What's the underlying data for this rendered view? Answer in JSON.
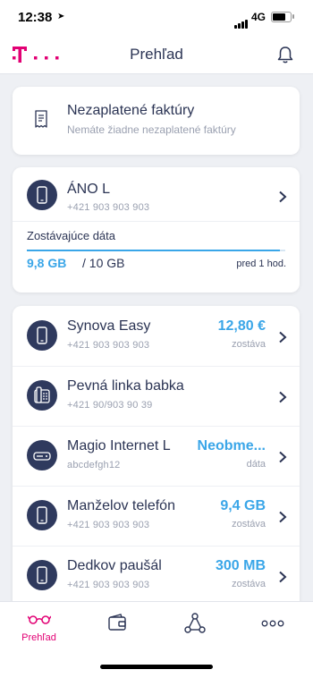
{
  "status_bar": {
    "time": "12:38",
    "network": "4G"
  },
  "header": {
    "title": "Prehľad"
  },
  "unpaid_card": {
    "title": "Nezaplatené faktúry",
    "subtitle": "Nemáte žiadne nezaplatené faktúry"
  },
  "main_plan": {
    "name": "ÁNO L",
    "number": "+421 903 903 903",
    "data_label": "Zostávajúce dáta",
    "remaining": "9,8 GB",
    "total": "/ 10 GB",
    "remaining_fraction": 0.98,
    "updated": "pred 1 hod."
  },
  "services": [
    {
      "name": "Synova Easy",
      "number": "+421 903 903 903",
      "value": "12,80 €",
      "unit": "zostáva",
      "icon": "phone-icon"
    },
    {
      "name": "Pevná linka babka",
      "number": "+421 90/903 90 39",
      "value": "",
      "unit": "",
      "icon": "landline-icon"
    },
    {
      "name": "Magio Internet L",
      "number": "abcdefgh12",
      "value": "Neobme...",
      "unit": "dáta",
      "icon": "router-icon"
    },
    {
      "name": "Manželov telefón",
      "number": "+421 903 903 903",
      "value": "9,4 GB",
      "unit": "zostáva",
      "icon": "phone-icon"
    },
    {
      "name": "Dedkov paušál",
      "number": "+421 903 903 903",
      "value": "300 MB",
      "unit": "zostáva",
      "icon": "phone-icon"
    }
  ],
  "tabs": [
    {
      "label": "Prehľad",
      "icon": "glasses-icon",
      "active": true
    },
    {
      "label": "",
      "icon": "wallet-icon",
      "active": false
    },
    {
      "label": "",
      "icon": "share-icon",
      "active": false
    },
    {
      "label": "",
      "icon": "more-icon",
      "active": false
    }
  ],
  "colors": {
    "brand": "#e20074",
    "accent": "#3aa6e8",
    "navy": "#2f3a5e"
  }
}
